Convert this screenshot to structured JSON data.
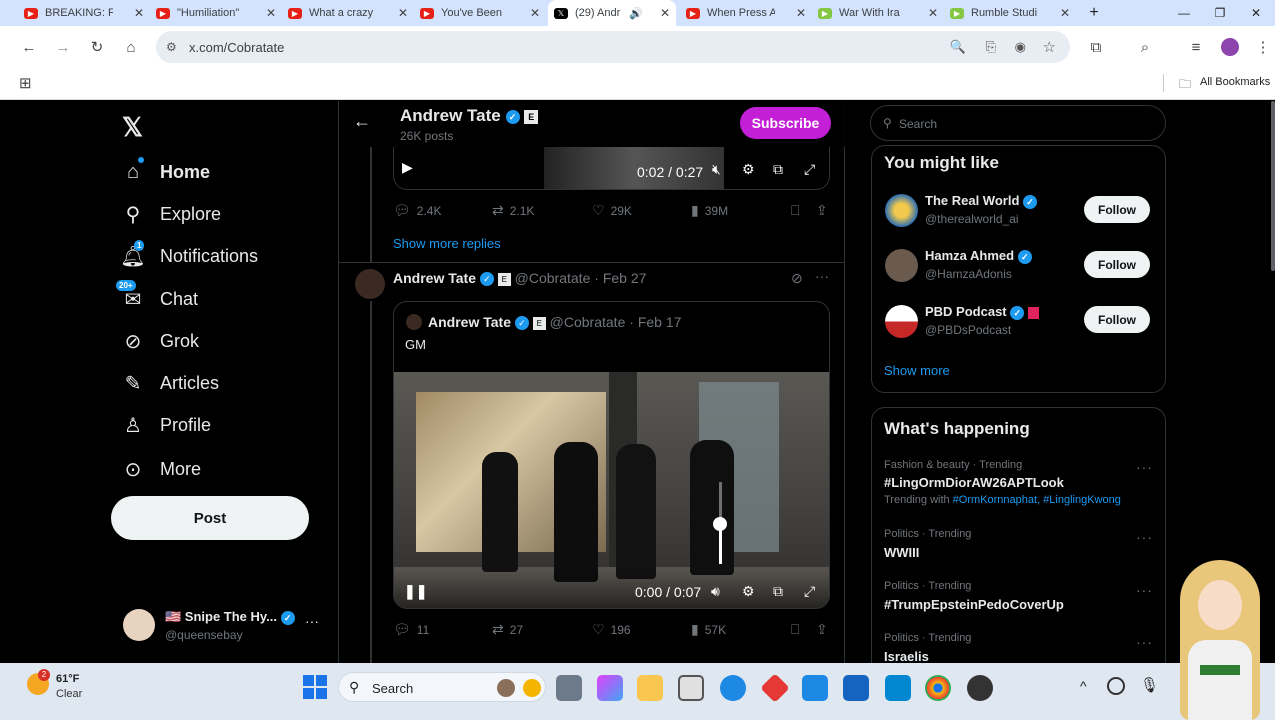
{
  "browser": {
    "tabs": [
      {
        "title": "BREAKING: F",
        "color": "#e62117"
      },
      {
        "title": "\"Humiliation\"",
        "color": "#e62117"
      },
      {
        "title": "What a crazy",
        "color": "#e62117"
      },
      {
        "title": "You've Been",
        "color": "#e62117"
      },
      {
        "title": "(29) Andr",
        "color": "#000000"
      },
      {
        "title": "When Press A",
        "color": "#e62117"
      },
      {
        "title": "War With Ira",
        "color": "#85c742"
      },
      {
        "title": "Rumble Studi",
        "color": "#85c742"
      }
    ],
    "url": "x.com/Cobratate",
    "all_bookmarks": "All Bookmarks"
  },
  "sidebar": {
    "items": [
      {
        "label": "Home",
        "icon": "home-icon"
      },
      {
        "label": "Explore",
        "icon": "search-icon"
      },
      {
        "label": "Notifications",
        "icon": "bell-icon",
        "badge": "1"
      },
      {
        "label": "Chat",
        "icon": "mail-icon",
        "badge": "20+"
      },
      {
        "label": "Grok",
        "icon": "grok-icon"
      },
      {
        "label": "Articles",
        "icon": "article-icon"
      },
      {
        "label": "Profile",
        "icon": "person-icon"
      },
      {
        "label": "More",
        "icon": "more-circle-icon"
      }
    ],
    "post_label": "Post",
    "account": {
      "name": "🇺🇸 Snipe The Hy...",
      "handle": "@queensebay"
    }
  },
  "header": {
    "name": "Andrew Tate",
    "posts": "26K posts",
    "subscribe": "Subscribe"
  },
  "feed": {
    "video1": {
      "time": "0:02 / 0:27"
    },
    "actions1": {
      "replies": "2.4K",
      "reposts": "2.1K",
      "likes": "29K",
      "views": "39M"
    },
    "show_more_replies": "Show more replies",
    "post": {
      "name": "Andrew Tate",
      "handle": "@Cobratate",
      "date": "Feb 27",
      "quote": {
        "name": "Andrew Tate",
        "handle": "@Cobratate",
        "date": "Feb 17",
        "text": "GM"
      },
      "video_time": "0:00 / 0:07",
      "actions": {
        "replies": "11",
        "reposts": "27",
        "likes": "196",
        "views": "57K"
      }
    }
  },
  "right": {
    "search_placeholder": "Search",
    "you_might_like": "You might like",
    "suggestions": [
      {
        "name": "The Real World",
        "handle": "@therealworld_ai",
        "follow": "Follow"
      },
      {
        "name": "Hamza Ahmed",
        "handle": "@HamzaAdonis",
        "follow": "Follow"
      },
      {
        "name": "PBD Podcast",
        "handle": "@PBDsPodcast",
        "follow": "Follow"
      }
    ],
    "show_more": "Show more",
    "whats_happening": "What's happening",
    "trends": [
      {
        "meta": "Fashion & beauty · Trending",
        "title": "#LingOrmDiorAW26APTLook",
        "sub_prefix": "Trending with ",
        "sub_tags": "#OrmKornnaphat, #LinglingKwong"
      },
      {
        "meta": "Politics · Trending",
        "title": "WWIII"
      },
      {
        "meta": "Politics · Trending",
        "title": "#TrumpEpsteinPedoCoverUp"
      },
      {
        "meta": "Politics · Trending",
        "title": "Israelis"
      }
    ]
  },
  "taskbar": {
    "weather_temp": "61°F",
    "weather_desc": "Clear",
    "weather_badge": "2",
    "search": "Search"
  }
}
